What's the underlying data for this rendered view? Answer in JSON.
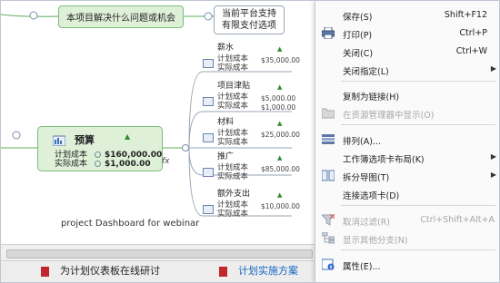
{
  "mindmap": {
    "topic_question": "本项目解决什么问题或机会",
    "topic_options": [
      "当前平台支持",
      "有限支付选项"
    ],
    "budget": {
      "title": "预算",
      "planned_label": "计划成本",
      "planned_value": "$160,000.00",
      "actual_label": "实际成本",
      "actual_value": "$1,000.00",
      "formula": "fx"
    },
    "subtopics": [
      {
        "name": "薪水",
        "planned_label": "计划成本",
        "actual_label": "实际成本",
        "planned_value": "$35,000.00",
        "actual_value": ""
      },
      {
        "name": "项目津贴",
        "planned_label": "计划成本",
        "actual_label": "实际成本",
        "planned_value": "$5,000.00",
        "actual_value": "$1,000.00"
      },
      {
        "name": "材料",
        "planned_label": "计划成本",
        "actual_label": "实际成本",
        "planned_value": "$25,000.00",
        "actual_value": ""
      },
      {
        "name": "推广",
        "planned_label": "计划成本",
        "actual_label": "实际成本",
        "planned_value": "$85,000.00",
        "actual_value": ""
      },
      {
        "name": "额外支出",
        "planned_label": "计划成本",
        "actual_label": "实际成本",
        "planned_value": "$10,000.00",
        "actual_value": ""
      }
    ],
    "caption": "project Dashboard for webinar"
  },
  "tabs": [
    {
      "label": "为计划仪表板在线研讨"
    },
    {
      "label": "计划实施方案"
    }
  ],
  "context_menu": {
    "items": [
      {
        "label": "保存(S)",
        "shortcut": "Shift+F12",
        "icon": "",
        "disabled": false,
        "submenu": false
      },
      {
        "label": "打印(P)",
        "shortcut": "Ctrl+P",
        "icon": "printer-icon",
        "disabled": false,
        "submenu": false
      },
      {
        "label": "关闭(C)",
        "shortcut": "Ctrl+W",
        "icon": "",
        "disabled": false,
        "submenu": false
      },
      {
        "label": "关闭指定(L)",
        "shortcut": "",
        "icon": "",
        "disabled": false,
        "submenu": true
      },
      {
        "label": "复制为链接(H)",
        "shortcut": "",
        "icon": "",
        "disabled": false,
        "submenu": false
      },
      {
        "label": "在资源管理器中显示(O)",
        "shortcut": "",
        "icon": "folder-icon",
        "disabled": true,
        "submenu": false
      },
      {
        "label": "排列(A)...",
        "shortcut": "",
        "icon": "arrange-icon",
        "disabled": false,
        "submenu": false
      },
      {
        "label": "工作簿选项卡布局(K)",
        "shortcut": "",
        "icon": "",
        "disabled": false,
        "submenu": true
      },
      {
        "label": "拆分导图(T)",
        "shortcut": "",
        "icon": "split-icon",
        "disabled": false,
        "submenu": true
      },
      {
        "label": "连接选项卡(D)",
        "shortcut": "",
        "icon": "",
        "disabled": false,
        "submenu": false
      },
      {
        "label": "取消过滤(R)",
        "shortcut": "Ctrl+Shift+Alt+A",
        "icon": "filter-icon",
        "disabled": true,
        "submenu": false
      },
      {
        "label": "显示其他分支(N)",
        "shortcut": "",
        "icon": "branch-icon",
        "disabled": true,
        "submenu": false
      },
      {
        "label": "属性(E)...",
        "shortcut": "",
        "icon": "properties-icon",
        "disabled": false,
        "submenu": false
      }
    ]
  },
  "colors": {
    "topic_fill": "#dff0d8",
    "topic_border": "#7bbd7a",
    "tab_active_text": "#1565c0",
    "disabled_text": "#a6a6a6"
  }
}
